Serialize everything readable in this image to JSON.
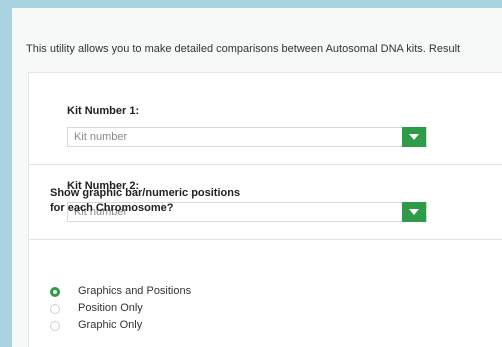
{
  "intro_text": "This utility allows you to make detailed comparisons between Autosomal DNA kits. Result",
  "kit1": {
    "label": "Kit Number 1:",
    "placeholder": "Kit number"
  },
  "kit2": {
    "label": "Kit Number 2:",
    "placeholder": "Kit number"
  },
  "display_option": {
    "question_line1": "Show graphic bar/numeric positions",
    "question_line2": "for each Chromosome?",
    "options": [
      {
        "label": "Graphics and Positions",
        "selected": true
      },
      {
        "label": "Position Only",
        "selected": false
      },
      {
        "label": "Graphic Only",
        "selected": false
      }
    ]
  },
  "colors": {
    "accent": "#2d9b48",
    "background": "#a9d4df"
  }
}
